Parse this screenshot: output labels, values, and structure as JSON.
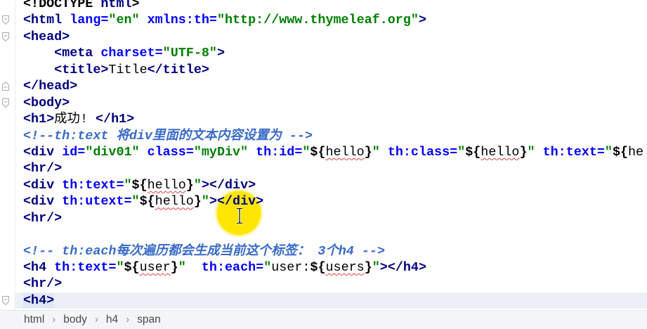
{
  "colors": {
    "tag": "#000080",
    "attribute": "#0000ff",
    "value": "#008000",
    "comment": "#3a6bc9",
    "squiggle": "#e0403a",
    "current_line": "#edf1f7",
    "matched_tag": "#dfe7f3",
    "cursor_highlight": "#ffe600",
    "fold_marker": "#a8a8a8"
  },
  "editor": {
    "lines": [
      {
        "tokens": [
          {
            "doc": "<!DOCTYPE "
          },
          {
            "tag": "html"
          },
          {
            "doc": ">"
          }
        ]
      },
      {
        "fold": "fold-open-icon",
        "tokens": [
          {
            "tag": "<html"
          },
          {
            "attr": " lang="
          },
          {
            "val": "\"en\""
          },
          {
            "attr": " xmlns:th="
          },
          {
            "val": "\"http://www.thymeleaf.org\""
          },
          {
            "tag": ">"
          }
        ]
      },
      {
        "fold": "fold-open-icon",
        "tokens": [
          {
            "tag": "<head>"
          }
        ]
      },
      {
        "tokens": [
          {
            "txt": "    "
          },
          {
            "tag": "<meta"
          },
          {
            "attr": " charset="
          },
          {
            "val": "\"UTF-8\""
          },
          {
            "tag": ">"
          }
        ]
      },
      {
        "tokens": [
          {
            "txt": "    "
          },
          {
            "tag": "<title>"
          },
          {
            "txt": "Title"
          },
          {
            "tag": "</title>"
          }
        ]
      },
      {
        "fold": "fold-close-icon",
        "tokens": [
          {
            "tag": "</head>"
          }
        ]
      },
      {
        "fold": "fold-open-icon",
        "tokens": [
          {
            "tag": "<body>"
          }
        ]
      },
      {
        "tokens": [
          {
            "tag": "<h1>"
          },
          {
            "txt": "成功! "
          },
          {
            "tag": "</h1>"
          }
        ]
      },
      {
        "tokens": [
          {
            "cm": "<!--th:text 将div里面的文本内容设置为 -->"
          }
        ]
      },
      {
        "tokens": [
          {
            "tag": "<div"
          },
          {
            "attr": " id="
          },
          {
            "val": "\"div01\""
          },
          {
            "attr": " class="
          },
          {
            "val": "\"myDiv\""
          },
          {
            "attr": " th:id="
          },
          {
            "val": "\""
          },
          {
            "ex": "${"
          },
          {
            "id": "hello"
          },
          {
            "ex": "}"
          },
          {
            "val": "\""
          },
          {
            "attr": " th:class="
          },
          {
            "val": "\""
          },
          {
            "ex": "${"
          },
          {
            "id": "hello"
          },
          {
            "ex": "}"
          },
          {
            "val": "\""
          },
          {
            "attr": " th:text="
          },
          {
            "val": "\""
          },
          {
            "ex": "${"
          },
          {
            "txt": "he"
          }
        ]
      },
      {
        "tokens": [
          {
            "tag": "<hr/>"
          }
        ]
      },
      {
        "tokens": [
          {
            "tag": "<div"
          },
          {
            "attr": " th:text="
          },
          {
            "val": "\""
          },
          {
            "ex": "${"
          },
          {
            "id": "hello"
          },
          {
            "ex": "}"
          },
          {
            "val": "\""
          },
          {
            "tag": "></div>"
          }
        ]
      },
      {
        "tokens": [
          {
            "tag": "<div"
          },
          {
            "attr": " th:utext="
          },
          {
            "val": "\""
          },
          {
            "ex": "${"
          },
          {
            "id": "hello"
          },
          {
            "ex": "}"
          },
          {
            "val": "\""
          },
          {
            "tag": "></div>"
          }
        ]
      },
      {
        "tokens": [
          {
            "tag": "<hr/>"
          }
        ]
      },
      {
        "tokens": []
      },
      {
        "tokens": [
          {
            "cm": "<!-- th:each每次遍历都会生成当前这个标签： 3个h4 -->"
          }
        ]
      },
      {
        "tokens": [
          {
            "tag": "<h4"
          },
          {
            "attr": " th:text="
          },
          {
            "val": "\""
          },
          {
            "ex": "${"
          },
          {
            "id": "user"
          },
          {
            "ex": "}"
          },
          {
            "val": "\""
          },
          {
            "attr": "  th:each="
          },
          {
            "val": "\""
          },
          {
            "txt": "user:"
          },
          {
            "ex": "${"
          },
          {
            "id": "users"
          },
          {
            "ex": "}"
          },
          {
            "val": "\""
          },
          {
            "tag": "></h4>"
          }
        ]
      },
      {
        "tokens": [
          {
            "tag": "<hr/>"
          }
        ]
      },
      {
        "fold": "fold-open-icon",
        "current": true,
        "tokens": [
          {
            "tagm": "<h4>"
          }
        ]
      }
    ]
  },
  "breadcrumb": {
    "items": [
      "html",
      "body",
      "h4",
      "span"
    ],
    "separator": "›"
  }
}
